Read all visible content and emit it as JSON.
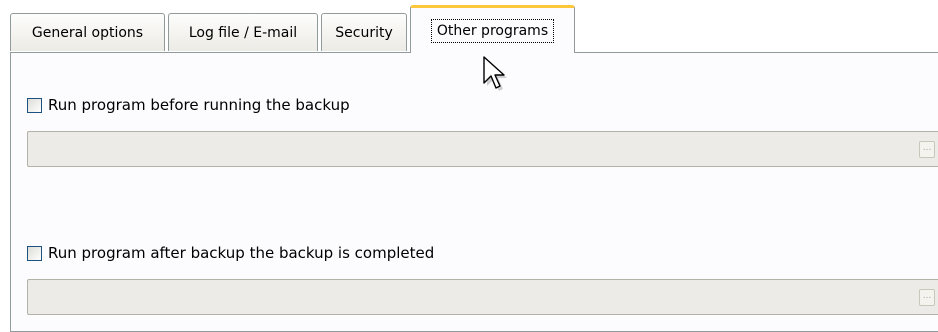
{
  "tabs": [
    {
      "label": "General options",
      "active": false
    },
    {
      "label": "Log file / E-mail",
      "active": false
    },
    {
      "label": "Security",
      "active": false
    },
    {
      "label": "Other programs",
      "active": true
    }
  ],
  "before_backup": {
    "checkbox_label": "Run program before running the backup",
    "checked": false,
    "path_value": "",
    "browse_label": "..."
  },
  "after_backup": {
    "checkbox_label": "Run program after backup the backup is completed",
    "checked": false,
    "path_value": "",
    "browse_label": "..."
  },
  "cursor": {
    "icon": "arrow-pointer-icon"
  },
  "colors": {
    "tab_border": "#919b9c",
    "active_tab_highlight": "#ffc83c",
    "panel_bg": "#fcfcfe",
    "field_bg": "#ecebe7",
    "checkbox_border": "#1c5180"
  }
}
